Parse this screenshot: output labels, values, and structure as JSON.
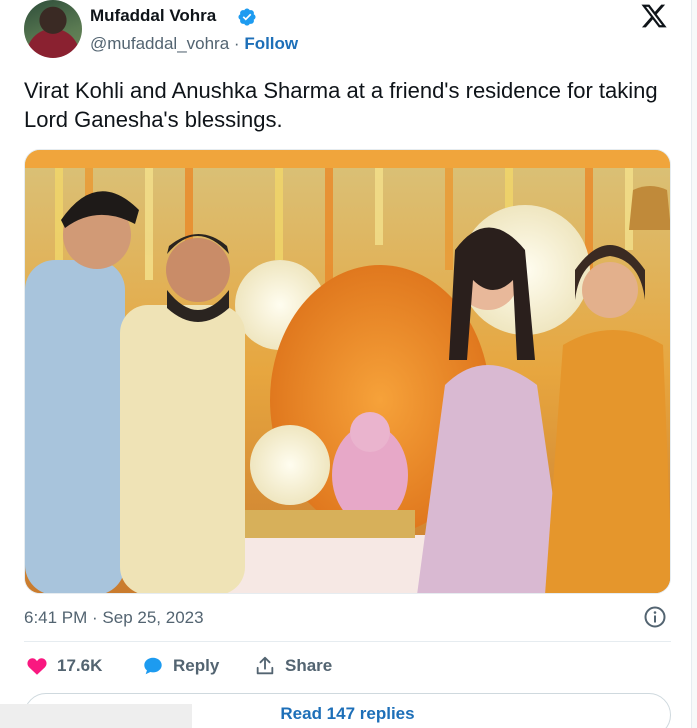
{
  "author": {
    "name": "Mufaddal Vohra",
    "handle": "@mufaddal_vohra",
    "separator": "·",
    "follow_label": "Follow"
  },
  "tweet": {
    "text": "Virat Kohli and Anushka Sharma at a friend's residence for taking Lord Ganesha's blessings.",
    "timestamp": "6:41 PM · Sep 25, 2023"
  },
  "actions": {
    "likes": "17.6K",
    "reply_label": "Reply",
    "share_label": "Share"
  },
  "read_replies_label": "Read 147 replies",
  "colors": {
    "link": "#1d6fb8",
    "verified": "#1d9bf0",
    "like_heart": "#f91880",
    "reply_bubble": "#1d9bf0",
    "muted_text": "#536471"
  },
  "icons": [
    "verified-badge-icon",
    "x-logo-icon",
    "info-icon",
    "heart-icon",
    "reply-bubble-icon",
    "share-icon"
  ]
}
